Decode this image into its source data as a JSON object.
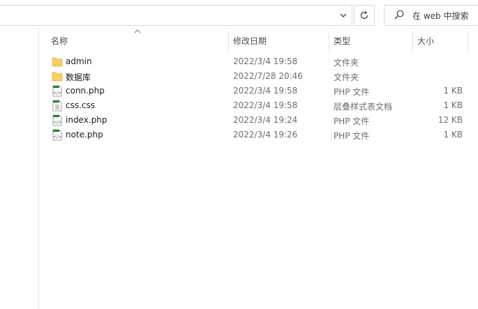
{
  "search": {
    "placeholder": "在 web 中搜索"
  },
  "icons": {
    "dropdown": "chevron-down-icon",
    "refresh": "refresh-icon",
    "search": "search-icon",
    "sort": "sort-up-icon",
    "folder": "folder-icon",
    "php_file": "php-file-icon",
    "css_file": "css-file-icon"
  },
  "colors": {
    "folder": "#f7cf63",
    "php_accent": "#2f7d32",
    "text_muted": "#6d6d6d"
  },
  "columns": {
    "name": "名称",
    "date": "修改日期",
    "type": "类型",
    "size": "大小"
  },
  "files": [
    {
      "name": "admin",
      "date": "2022/3/4 19:58",
      "type": "文件夹",
      "size": "",
      "kind": "folder"
    },
    {
      "name": "数据库",
      "date": "2022/7/28 20:46",
      "type": "文件夹",
      "size": "",
      "kind": "folder"
    },
    {
      "name": "conn.php",
      "date": "2022/3/4 19:58",
      "type": "PHP 文件",
      "size": "1 KB",
      "kind": "php"
    },
    {
      "name": "css.css",
      "date": "2022/3/4 19:58",
      "type": "层叠样式表文档",
      "size": "1 KB",
      "kind": "css"
    },
    {
      "name": "index.php",
      "date": "2022/3/4 19:24",
      "type": "PHP 文件",
      "size": "12 KB",
      "kind": "php"
    },
    {
      "name": "note.php",
      "date": "2022/3/4 19:26",
      "type": "PHP 文件",
      "size": "1 KB",
      "kind": "php"
    }
  ]
}
